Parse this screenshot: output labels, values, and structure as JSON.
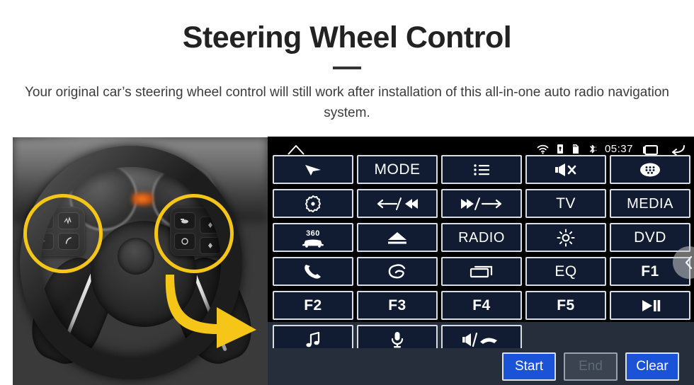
{
  "header": {
    "title": "Steering Wheel Control",
    "subtitle": "Your original car’s steering wheel control will still work after installation of this all-in-one auto radio navigation system."
  },
  "photo": {
    "alt": "steering-wheel-photo",
    "highlight_color": "#f5c518",
    "arrow_color": "#f5c518"
  },
  "radio": {
    "statusbar": {
      "home_icon": "home-icon",
      "wifi_icon": "wifi-icon",
      "usb_icon": "usb-icon",
      "sdcard_icon": "sdcard-icon",
      "bluetooth_icon": "bluetooth-icon",
      "time": "05:37",
      "recents_icon": "recents-icon",
      "back_icon": "back-icon"
    },
    "colors": {
      "panel_bg": "#000000",
      "panel_slate": "#262e3b",
      "button_fill": "#111c33",
      "button_border": "#d8dce3",
      "accent_blue": "#1a52d8",
      "disabled_gray": "#3b4350"
    },
    "grid": {
      "columns": 5,
      "rows": 6,
      "buttons": [
        {
          "name": "navigation",
          "type": "icon",
          "icon": "navigation-arrow-icon",
          "label": ""
        },
        {
          "name": "mode",
          "type": "text",
          "icon": "",
          "label": "MODE"
        },
        {
          "name": "menu-list",
          "type": "icon",
          "icon": "list-menu-icon",
          "label": ""
        },
        {
          "name": "mute",
          "type": "icon",
          "icon": "speaker-mute-icon",
          "label": ""
        },
        {
          "name": "apps",
          "type": "icon",
          "icon": "apps-grid-icon",
          "label": ""
        },
        {
          "name": "settings",
          "type": "icon",
          "icon": "gear-dot-icon",
          "label": ""
        },
        {
          "name": "prev-track",
          "type": "icon",
          "icon": "prev-seek-icon",
          "label": ""
        },
        {
          "name": "next-track",
          "type": "icon",
          "icon": "next-seek-icon",
          "label": ""
        },
        {
          "name": "tv",
          "type": "text",
          "icon": "",
          "label": "TV"
        },
        {
          "name": "media",
          "type": "text",
          "icon": "",
          "label": "MEDIA"
        },
        {
          "name": "camera-360",
          "type": "icon",
          "icon": "car-360-icon",
          "label": "360"
        },
        {
          "name": "eject",
          "type": "icon",
          "icon": "eject-icon",
          "label": ""
        },
        {
          "name": "radio",
          "type": "text",
          "icon": "",
          "label": "RADIO"
        },
        {
          "name": "brightness",
          "type": "icon",
          "icon": "brightness-sun-icon",
          "label": ""
        },
        {
          "name": "dvd",
          "type": "text",
          "icon": "",
          "label": "DVD"
        },
        {
          "name": "phone-call",
          "type": "icon",
          "icon": "phone-handset-icon",
          "label": ""
        },
        {
          "name": "swirl",
          "type": "icon",
          "icon": "swirl-icon",
          "label": ""
        },
        {
          "name": "desktop",
          "type": "icon",
          "icon": "window-rectangle-icon",
          "label": ""
        },
        {
          "name": "eq",
          "type": "text",
          "icon": "",
          "label": "EQ"
        },
        {
          "name": "f1",
          "type": "text",
          "icon": "",
          "label": "F1"
        },
        {
          "name": "f2",
          "type": "text",
          "icon": "",
          "label": "F2"
        },
        {
          "name": "f3",
          "type": "text",
          "icon": "",
          "label": "F3"
        },
        {
          "name": "f4",
          "type": "text",
          "icon": "",
          "label": "F4"
        },
        {
          "name": "f5",
          "type": "text",
          "icon": "",
          "label": "F5"
        },
        {
          "name": "play-pause",
          "type": "icon",
          "icon": "play-pause-icon",
          "label": ""
        },
        {
          "name": "music",
          "type": "icon",
          "icon": "music-note-icon",
          "label": ""
        },
        {
          "name": "voice",
          "type": "icon",
          "icon": "microphone-icon",
          "label": ""
        },
        {
          "name": "answer-hangup",
          "type": "icon",
          "icon": "speaker-hangup-icon",
          "label": ""
        },
        {
          "name": "empty-1",
          "type": "empty",
          "icon": "",
          "label": ""
        },
        {
          "name": "empty-2",
          "type": "empty",
          "icon": "",
          "label": ""
        }
      ]
    },
    "actions": {
      "start": "Start",
      "end": "End",
      "clear": "Clear"
    },
    "carousel": {
      "prev_icon": "chevron-left-icon"
    }
  }
}
